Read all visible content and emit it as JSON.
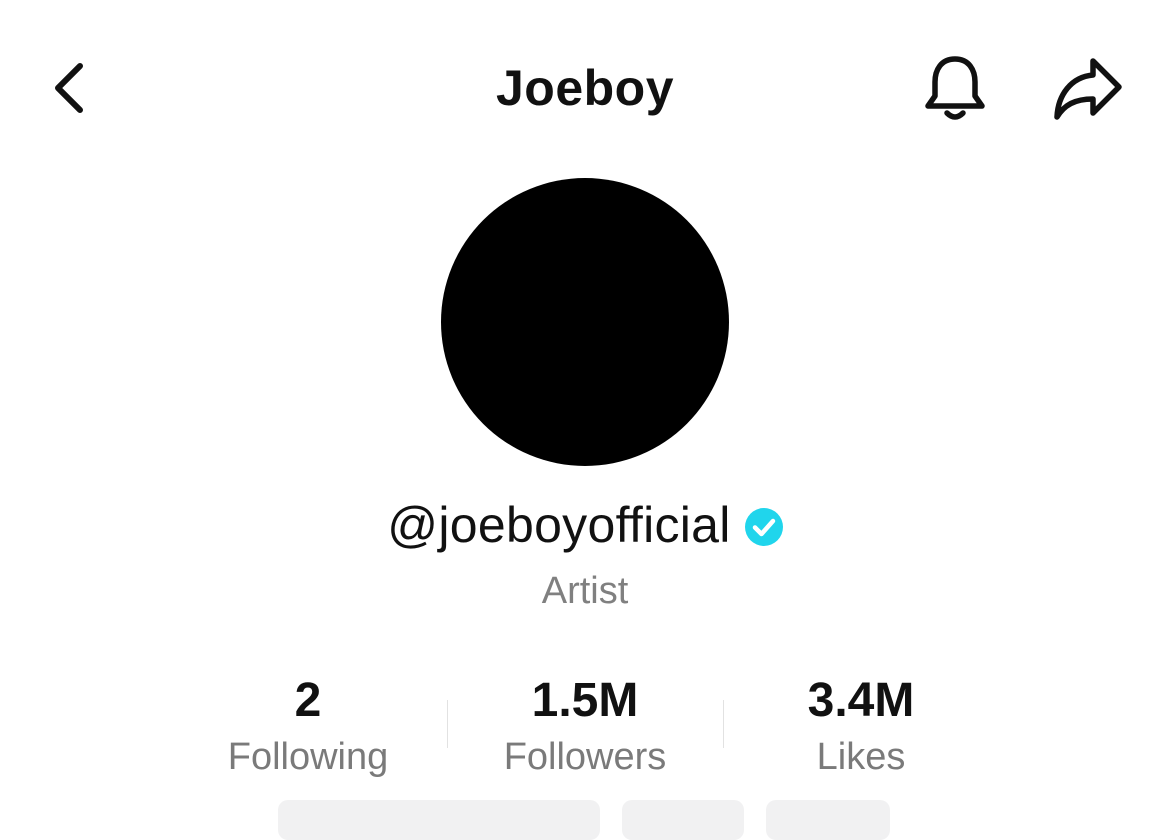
{
  "header": {
    "title": "Joeboy",
    "back_icon": "chevron-left-icon",
    "bell_icon": "bell-icon",
    "share_icon": "share-arrow-icon"
  },
  "profile": {
    "handle": "@joeboyofficial",
    "verified_icon": "verified-badge-icon",
    "verified_color": "#20d5ec",
    "bio": "Artist"
  },
  "stats": [
    {
      "value": "2",
      "label": "Following"
    },
    {
      "value": "1.5M",
      "label": "Followers"
    },
    {
      "value": "3.4M",
      "label": "Likes"
    }
  ]
}
